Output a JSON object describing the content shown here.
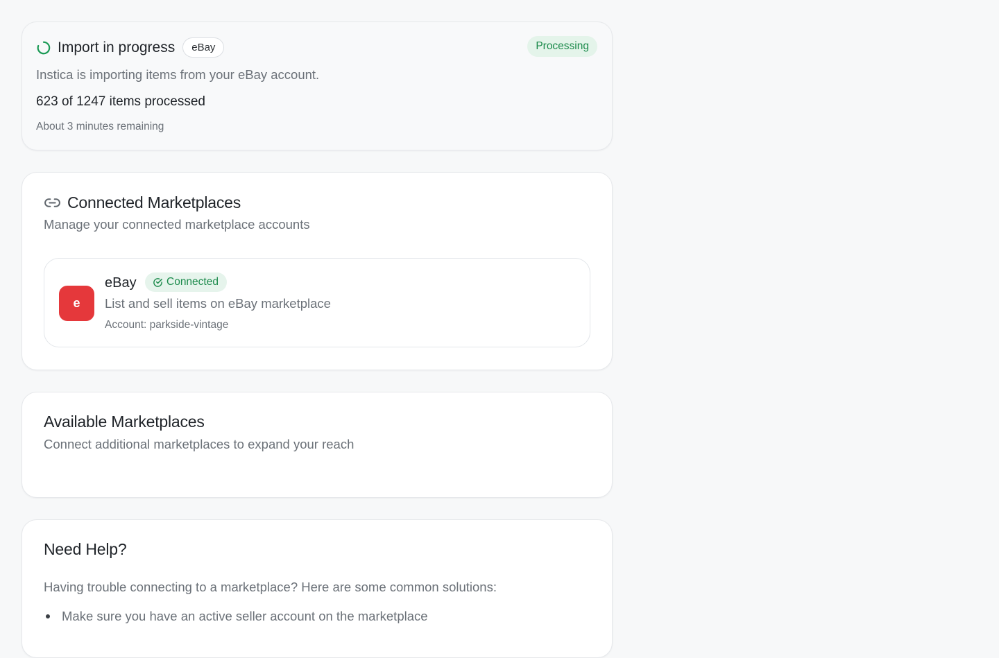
{
  "import_status": {
    "title": "Import in progress",
    "source_chip": "eBay",
    "status_badge": "Processing",
    "description": "Instica is importing items from your eBay account.",
    "progress_text": "623 of 1247 items processed",
    "progress": {
      "processed": 623,
      "total": 1247
    },
    "time_remaining": "About 3 minutes remaining"
  },
  "connected": {
    "title": "Connected Marketplaces",
    "subtitle": "Manage your connected marketplace accounts",
    "items": [
      {
        "logo_letter": "e",
        "name": "eBay",
        "status": "Connected",
        "description": "List and sell items on eBay marketplace",
        "account": "Account: parkside-vintage"
      }
    ]
  },
  "available": {
    "title": "Available Marketplaces",
    "subtitle": "Connect additional marketplaces to expand your reach"
  },
  "help": {
    "title": "Need Help?",
    "intro": "Having trouble connecting to a marketplace? Here are some common solutions:",
    "tips": [
      "Make sure you have an active seller account on the marketplace"
    ]
  },
  "colors": {
    "accent_green": "#1b8a4b",
    "badge_green_bg": "#e4f4ea",
    "ebay_logo_red": "#e5383b",
    "page_bg": "#f7f8f9"
  },
  "icons": {
    "spinner": "loading-spinner-icon",
    "link": "link-icon",
    "check": "check-circle-icon"
  }
}
